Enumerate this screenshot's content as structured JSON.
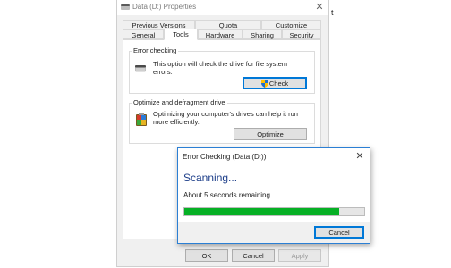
{
  "properties_window": {
    "title": "Data (D:) Properties",
    "tabs_row1": [
      "Previous Versions",
      "Quota",
      "Customize"
    ],
    "tabs_row2": [
      "General",
      "Tools",
      "Hardware",
      "Sharing",
      "Security"
    ],
    "selected_tab": "Tools",
    "error_checking": {
      "title": "Error checking",
      "description": "This option will check the drive for file system errors.",
      "button": "Check"
    },
    "optimize": {
      "title": "Optimize and defragment drive",
      "description": "Optimizing your computer's drives can help it run more efficiently.",
      "button": "Optimize"
    },
    "footer": {
      "ok": "OK",
      "cancel": "Cancel",
      "apply": "Apply"
    }
  },
  "error_dialog": {
    "title": "Error Checking (Data (D:))",
    "heading": "Scanning...",
    "remaining": "About 5 seconds remaining",
    "progress_fraction": 0.86,
    "cancel": "Cancel"
  },
  "colors": {
    "progress": "#06b025",
    "heading": "#1e3f8a",
    "accent": "#0078d7"
  },
  "icons": {
    "window": "drive-icon",
    "error_checking": "drive-icon",
    "check_button": "shield-icon",
    "optimize": "defrag-icon"
  }
}
